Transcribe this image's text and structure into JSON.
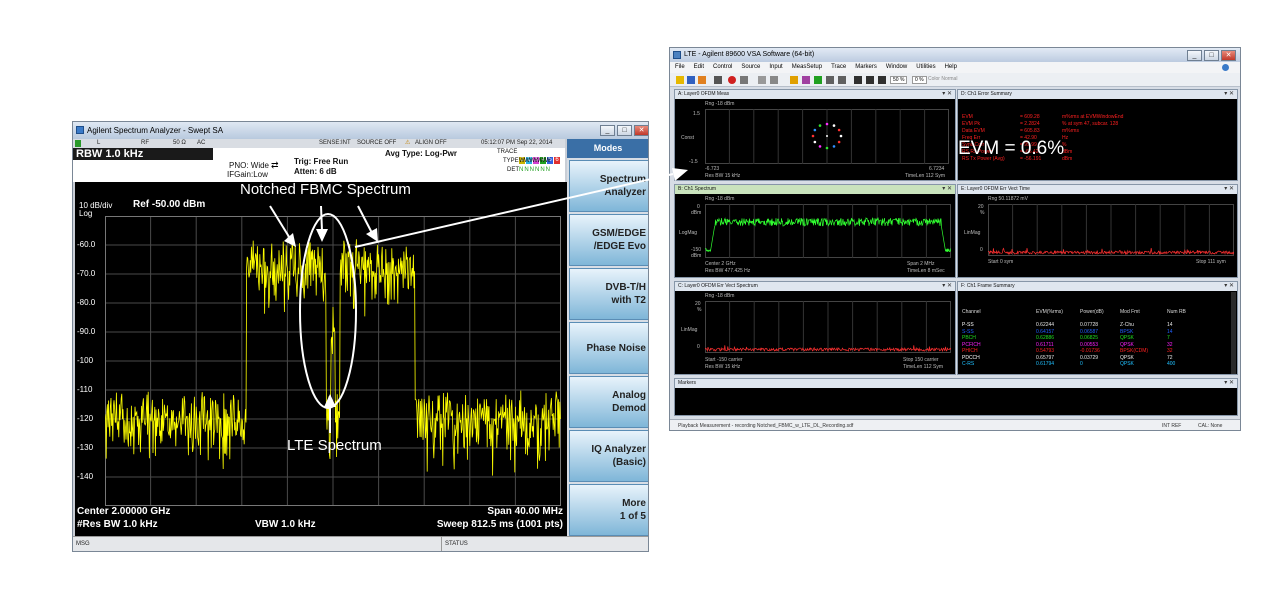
{
  "spectrum_analyzer": {
    "window_title": "Agilent Spectrum Analyzer - Swept SA",
    "status_bar": {
      "input": "L",
      "coupling": "RF",
      "impedance": "50 Ω",
      "ac": "AC",
      "sense": "SENSE:INT",
      "source": "SOURCE OFF",
      "align": "ALIGN OFF",
      "datetime": "05:12:07 PM Sep 22, 2014"
    },
    "rbw_header": "RBW 1.0 kHz",
    "pno": "PNO: Wide",
    "ifgain": "IFGain:Low",
    "trig": "Trig: Free Run",
    "atten": "Atten: 6 dB",
    "avg_type": "Avg Type: Log-Pwr",
    "trace_labels": {
      "trace": "TRACE",
      "type": "TYPE",
      "det": "DET"
    },
    "trace_boxes": [
      "1",
      "2",
      "3",
      "4",
      "5",
      "6"
    ],
    "type_value": "WWWWWW",
    "det_value": "NNNNNN",
    "scale": "10 dB/div",
    "scale_type": "Log",
    "ref": "Ref -50.00 dBm",
    "y_ticks": [
      "-60.0",
      "-70.0",
      "-80.0",
      "-90.0",
      "-100",
      "-110",
      "-120",
      "-130",
      "-140"
    ],
    "center": "Center 2.00000 GHz",
    "res_bw": "#Res BW 1.0 kHz",
    "vbw": "VBW 1.0 kHz",
    "span": "Span 40.00 MHz",
    "sweep": "Sweep  812.5 ms (1001 pts)",
    "msg_label": "MSG",
    "status_label": "STATUS",
    "modes_title": "Modes",
    "mode_buttons": [
      "Spectrum\nAnalyzer",
      "GSM/EDGE\n/EDGE Evo",
      "DVB-T/H\nwith T2",
      "Phase Noise",
      "Analog\nDemod",
      "IQ Analyzer\n(Basic)",
      "More\n1 of 5"
    ]
  },
  "annotations": {
    "notched": "Notched FBMC Spectrum",
    "lte": "LTE Spectrum",
    "evm": "EVM = 0.6%"
  },
  "vsa": {
    "window_title": "LTE - Agilent 89600 VSA Software (64-bit)",
    "menu": [
      "File",
      "Edit",
      "Control",
      "Source",
      "Input",
      "MeasSetup",
      "Trace",
      "Markers",
      "Window",
      "Utilities",
      "Help"
    ],
    "toolbar_zoom": [
      "50 %",
      "0 %"
    ],
    "toolbar_color": "Color Normal",
    "pane_a": {
      "title": "A: Layer0 OFDM Meas",
      "range": "Rng -18 dBm",
      "y_top": "1.5",
      "y_label": "Const",
      "y_bottom": "-1.5",
      "x_left": "-6.723",
      "x_right": "6.7234",
      "foot_left": "Res BW 15 kHz",
      "foot_right": "TimeLen 112  Sym"
    },
    "pane_d": {
      "title": "D: Ch1 Error Summary",
      "rows": [
        {
          "k": "EVM",
          "v": "= 609.28",
          "u": "m%rms at  EVMWindowEnd"
        },
        {
          "k": "EVM Pk",
          "v": "= 2.2824",
          "u": "%  at  sym 47,  subcar. 128"
        },
        {
          "k": "Data EVM",
          "v": "= 605.83",
          "u": "m%rms"
        },
        {
          "k": "Freq Err",
          "v": "= 42.90",
          "u": "Hz"
        },
        {
          "k": "Sync Corr",
          "v": "= 99.99",
          "u": "%"
        },
        {
          "k": "RS Rx Power",
          "v": "= -65.42",
          "u": "dBm"
        },
        {
          "k": "RS Tx Power (Avg)",
          "v": "= -56.191",
          "u": "dBm"
        }
      ]
    },
    "pane_b": {
      "title": "B: Ch1 Spectrum",
      "range": "Rng -18 dBm",
      "y_top": "0",
      "y_top2": "dBm",
      "y_label": "LogMag",
      "y_bottom": "-150",
      "y_bottom2": "dBm",
      "center": "Center 2 GHz",
      "rbw": "Res BW 477.425  Hz",
      "span": "Span 2 MHz",
      "timelen": "TimeLen 8 mSec"
    },
    "pane_e": {
      "title": "E: Layer0 OFDM Err Vect Time",
      "range": "Rng 50.11872 mV",
      "y_top": "20",
      "y_unit": "%",
      "y_label": "LinMag",
      "y_bottom": "0",
      "start": "Start  0  sym",
      "stop": "Stop 111  sym"
    },
    "pane_c": {
      "title": "C: Layer0 OFDM Err Vect Spectrum",
      "range": "Rng -18 dBm",
      "y_top": "20",
      "y_unit": "%",
      "y_label": "LinMag",
      "y_bottom": "0",
      "start": "Start -150  carrier",
      "stop": "Stop 150  carrier",
      "rbw": "Res BW 15 kHz",
      "timelen": "TimeLen 112  Sym"
    },
    "pane_f": {
      "title": "F: Ch1 Frame Summary",
      "headers": [
        "Channel",
        "EVM(%rms)",
        "Power(dB)",
        "Mod Fmt",
        "Num RB"
      ],
      "rows": [
        {
          "ch": "P-SS",
          "evm": "0.62244",
          "pw": "0.07728",
          "mod": "Z-Chu",
          "rb": "14",
          "color": "#ffffff"
        },
        {
          "ch": "S-SS",
          "evm": "0.64157",
          "pw": "0.06587",
          "mod": "BPSK",
          "rb": "14",
          "color": "#2060ff"
        },
        {
          "ch": "PBCH",
          "evm": "0.62886",
          "pw": "0.06825",
          "mod": "QPSK",
          "rb": "7",
          "color": "#20e020"
        },
        {
          "ch": "PCFICH",
          "evm": "0.61711",
          "pw": "0.00553",
          "mod": "QPSK",
          "rb": "32",
          "color": "#ff20ff"
        },
        {
          "ch": "PHICH",
          "evm": "0.54793",
          "pw": "-0.01736",
          "mod": "BPSK(CDM)",
          "rb": "32",
          "color": "#ff2020"
        },
        {
          "ch": "PDCCH",
          "evm": "0.65797",
          "pw": "0.03729",
          "mod": "QPSK",
          "rb": "72",
          "color": "#ffffff"
        },
        {
          "ch": "C-RS",
          "evm": "0.61794",
          "pw": "0",
          "mod": "QPSK",
          "rb": "400",
          "color": "#20c0ff"
        }
      ]
    },
    "markers_title": "Markers",
    "status_left": "Playback Measurement - recording Notched_FBMC_w_LTE_DL_Recording.sdf",
    "status_ref": "INT REF",
    "status_cal": "CAL: None"
  }
}
